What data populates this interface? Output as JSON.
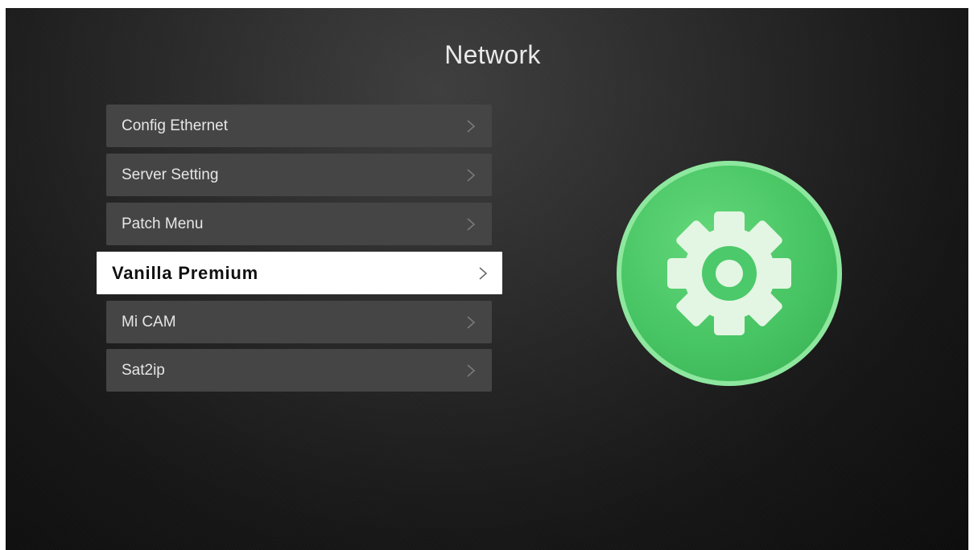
{
  "header": {
    "title": "Network"
  },
  "menu": {
    "items": [
      {
        "label": "Config Ethernet",
        "selected": false
      },
      {
        "label": "Server Setting",
        "selected": false
      },
      {
        "label": "Patch Menu",
        "selected": false
      },
      {
        "label": "Vanilla Premium",
        "selected": true
      },
      {
        "label": "Mi CAM",
        "selected": false
      },
      {
        "label": "Sat2ip",
        "selected": false
      }
    ]
  },
  "preview": {
    "icon": "gear-icon",
    "accent": "#4cc96a"
  },
  "colors": {
    "item_bg": "#454545",
    "selected_bg": "#ffffff",
    "chevron": "#8a8a8a"
  }
}
